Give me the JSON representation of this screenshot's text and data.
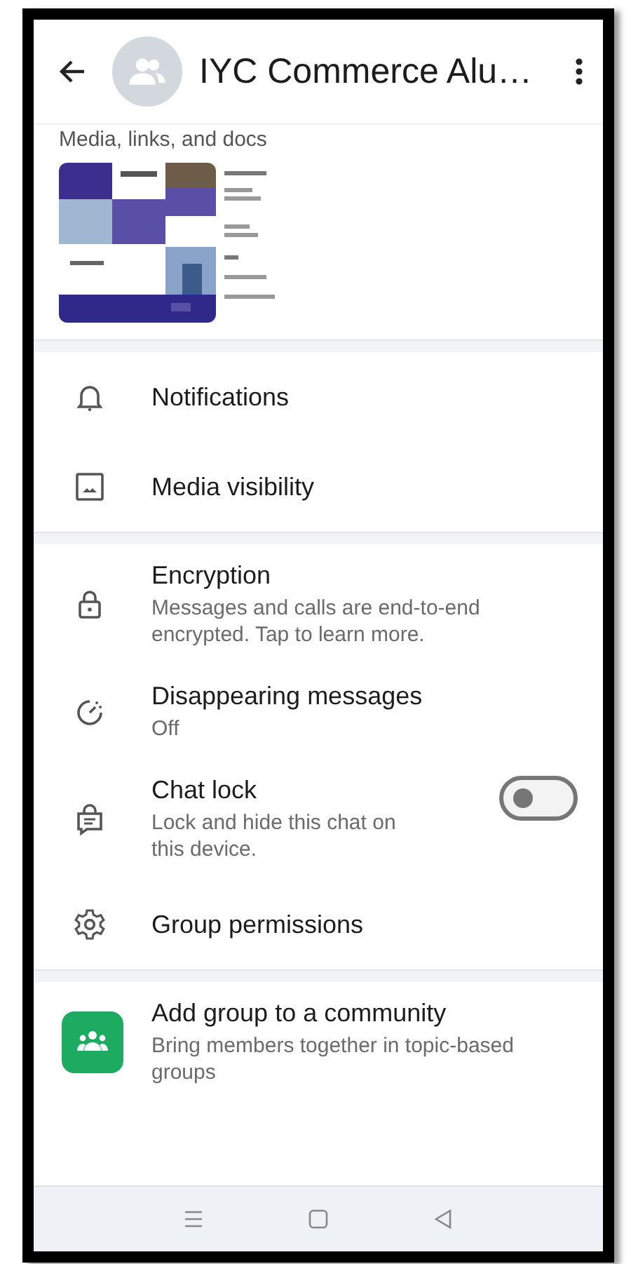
{
  "header": {
    "title": "IYC Commerce Alu…"
  },
  "media": {
    "heading": "Media, links, and docs"
  },
  "sections": [
    {
      "items": [
        {
          "kind": "plain",
          "title": "Notifications"
        },
        {
          "kind": "plain",
          "title": "Media visibility"
        }
      ]
    },
    {
      "items": [
        {
          "kind": "subtitle",
          "title": "Encryption",
          "subtitle": "Messages and calls are end-to-end encrypted. Tap to learn more."
        },
        {
          "kind": "subtitle",
          "title": "Disappearing messages",
          "subtitle": "Off"
        },
        {
          "kind": "toggle",
          "title": "Chat lock",
          "subtitle": "Lock and hide this chat on this device.",
          "on": false
        },
        {
          "kind": "plain",
          "title": "Group permissions"
        }
      ]
    },
    {
      "items": [
        {
          "kind": "community",
          "title": "Add group to a community",
          "subtitle": "Bring members together in topic-based groups"
        }
      ]
    }
  ]
}
